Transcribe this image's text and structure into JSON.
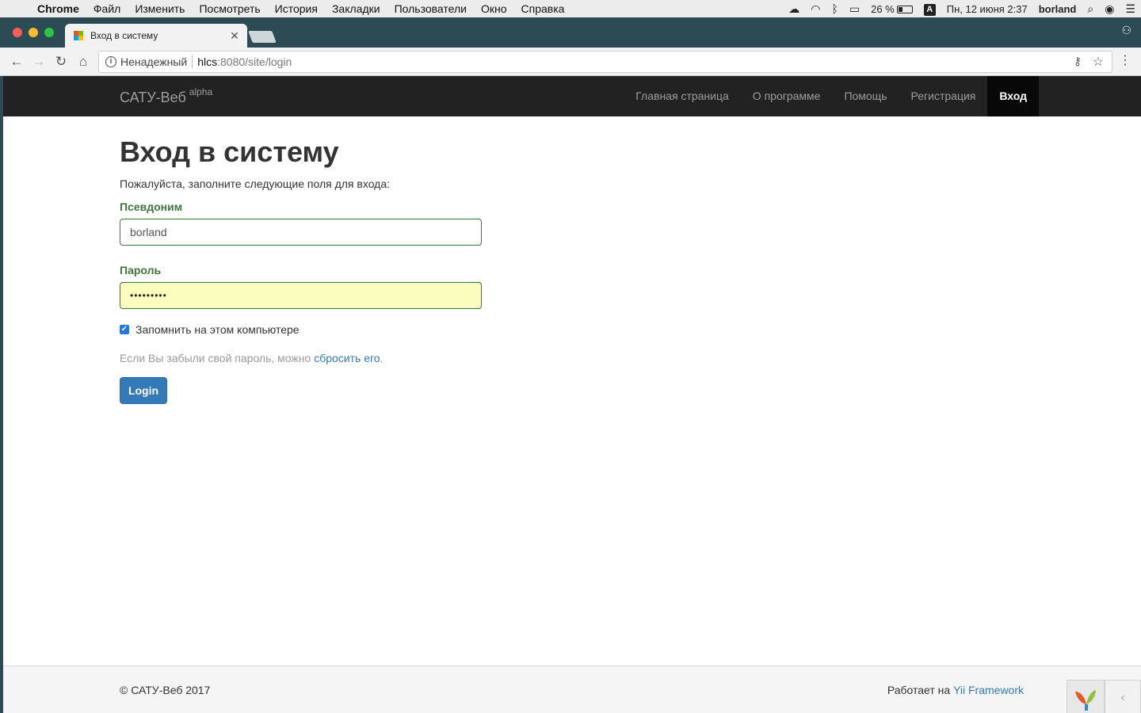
{
  "menubar": {
    "app": "Chrome",
    "items": [
      "Файл",
      "Изменить",
      "Посмотреть",
      "История",
      "Закладки",
      "Пользователи",
      "Окно",
      "Справка"
    ],
    "battery": "26 %",
    "input_source": "A",
    "datetime": "Пн, 12 июня  2:37",
    "user": "borland"
  },
  "browser": {
    "tab_title": "Вход в систему",
    "security_label": "Ненадежный",
    "url_host": "hlcs",
    "url_path": ":8080/site/login"
  },
  "navbar": {
    "brand": "САТУ-Веб",
    "brand_sup": "alpha",
    "links": [
      "Главная страница",
      "О программе",
      "Помощь",
      "Регистрация",
      "Вход"
    ],
    "active": "Вход"
  },
  "login": {
    "title": "Вход в систему",
    "subtitle": "Пожалуйста, заполните следующие поля для входа:",
    "username_label": "Псевдоним",
    "username_value": "borland",
    "password_label": "Пароль",
    "password_value": "•••••••••",
    "remember_label": "Запомнить на этом компьютере",
    "remember_checked": true,
    "reset_text": "Если Вы забыли свой пароль, можно ",
    "reset_link": "сбросить его",
    "reset_end": ".",
    "button": "Login"
  },
  "footer": {
    "copyright": "© САТУ-Веб 2017",
    "powered_text": "Работает на ",
    "powered_link": "Yii Framework"
  },
  "colors": {
    "navbar_bg": "#222222",
    "label_success": "#3c763d",
    "primary": "#337ab7",
    "autofill_bg": "#fbfdbf"
  }
}
